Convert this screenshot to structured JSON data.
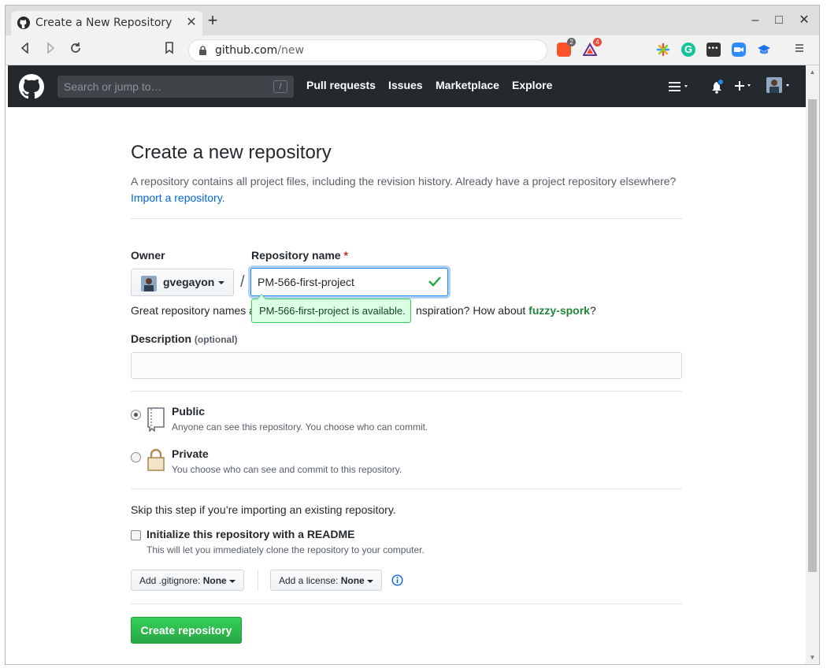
{
  "browser": {
    "tab_title": "Create a New Repository",
    "url_host": "github.com",
    "url_path": "/new",
    "brave_badge": "2",
    "bat_badge": "4"
  },
  "header": {
    "search_placeholder": "Search or jump to…",
    "search_shortcut": "/",
    "nav": [
      "Pull requests",
      "Issues",
      "Marketplace",
      "Explore"
    ]
  },
  "page": {
    "title": "Create a new repository",
    "subtitle": "A repository contains all project files, including the revision history. Already have a project repository elsewhere?",
    "import_link": "Import a repository",
    "import_suffix": ".",
    "owner_label": "Owner",
    "repo_label": "Repository name",
    "required_mark": "*",
    "owner_value": "gvegayon",
    "separator": "/",
    "repo_value": "PM-566-first-project",
    "availability_tooltip": "PM-566-first-project is available.",
    "hint_prefix": "Great repository names a",
    "hint_middle": "nspiration? How about ",
    "hint_suggestion": "fuzzy-spork",
    "hint_suffix": "?",
    "description_label": "Description",
    "description_optional": "(optional)",
    "description_value": "",
    "visibility": {
      "public_title": "Public",
      "public_note": "Anyone can see this repository. You choose who can commit.",
      "private_title": "Private",
      "private_note": "You choose who can see and commit to this repository.",
      "selected": "Public"
    },
    "skip_text": "Skip this step if you’re importing an existing repository.",
    "readme_label": "Initialize this repository with a README",
    "readme_note": "This will let you immediately clone the repository to your computer.",
    "readme_checked": false,
    "gitignore_label": "Add .gitignore:",
    "gitignore_value": "None",
    "license_label": "Add a license:",
    "license_value": "None",
    "create_button": "Create repository"
  },
  "colors": {
    "header_bg": "#24292e",
    "link": "#0366d6",
    "primary_button": "#28a745",
    "tooltip_bg": "#dcffe4"
  }
}
